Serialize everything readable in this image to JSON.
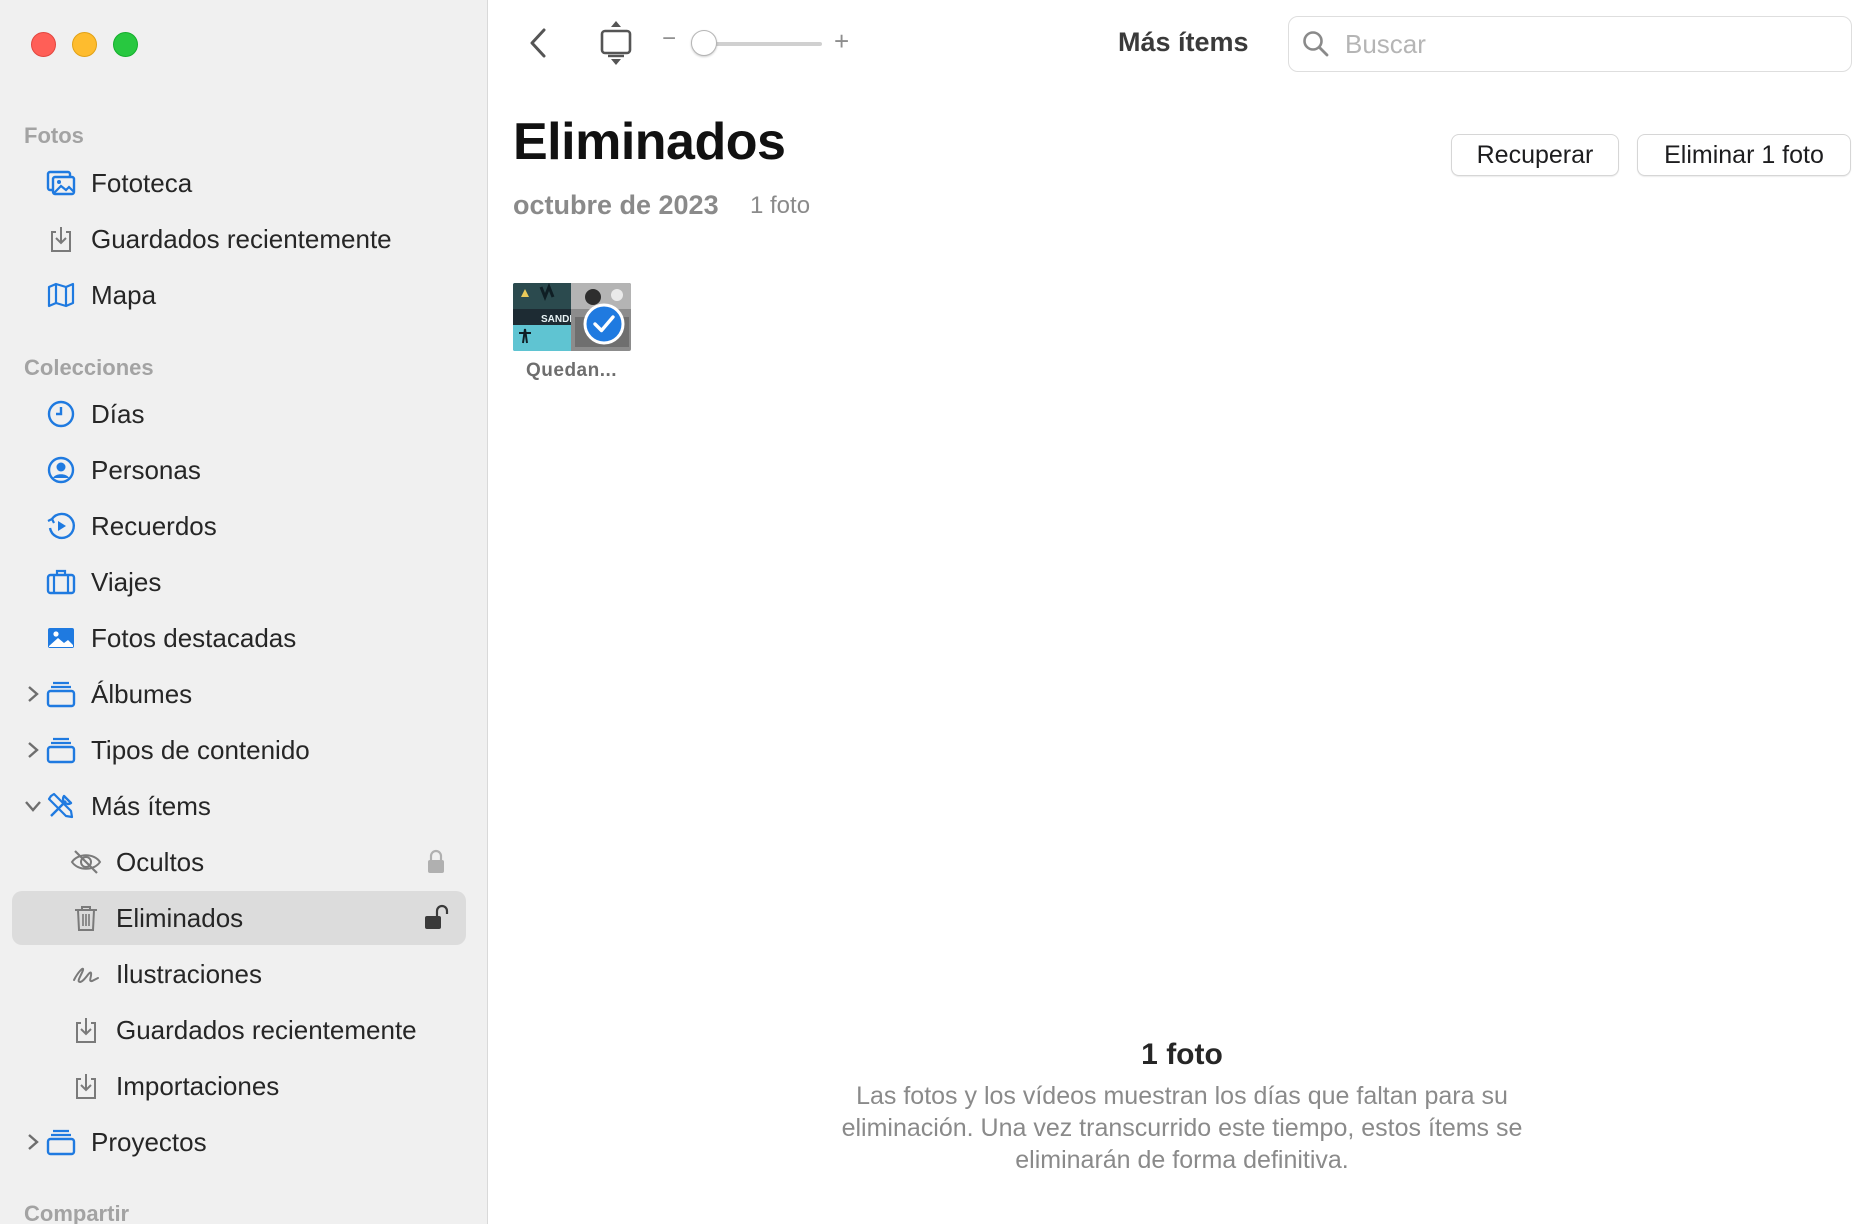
{
  "window": {
    "traffic_lights": [
      "close",
      "minimize",
      "maximize"
    ]
  },
  "sidebar": {
    "sections": {
      "fotos": "Fotos",
      "colecciones": "Colecciones",
      "compartir": "Compartir"
    },
    "items": {
      "fototeca": {
        "label": "Fototeca",
        "icon": "photo-library-icon"
      },
      "guardados": {
        "label": "Guardados recientemente",
        "icon": "download-tray-icon"
      },
      "mapa": {
        "label": "Mapa",
        "icon": "map-icon"
      },
      "dias": {
        "label": "Días",
        "icon": "clock-icon"
      },
      "personas": {
        "label": "Personas",
        "icon": "person-circle-icon"
      },
      "recuerdos": {
        "label": "Recuerdos",
        "icon": "memories-icon"
      },
      "viajes": {
        "label": "Viajes",
        "icon": "suitcase-icon"
      },
      "destacadas": {
        "label": "Fotos destacadas",
        "icon": "photo-icon"
      },
      "albumes": {
        "label": "Álbumes",
        "icon": "stack-icon"
      },
      "tipos": {
        "label": "Tipos de contenido",
        "icon": "stack-icon"
      },
      "mas": {
        "label": "Más ítems",
        "icon": "tools-icon"
      },
      "ocultos": {
        "label": "Ocultos",
        "icon": "eye-slash-icon"
      },
      "eliminados": {
        "label": "Eliminados",
        "icon": "trash-icon"
      },
      "ilustraciones": {
        "label": "Ilustraciones",
        "icon": "scribble-icon"
      },
      "guardados2": {
        "label": "Guardados recientemente",
        "icon": "download-tray-icon"
      },
      "importaciones": {
        "label": "Importaciones",
        "icon": "download-tray-icon"
      },
      "proyectos": {
        "label": "Proyectos",
        "icon": "stack-icon"
      }
    },
    "accent": "#1f7ae0"
  },
  "toolbar": {
    "title": "Más ítems",
    "zoom_minus": "−",
    "zoom_plus": "+",
    "zoom_level": 0.0,
    "search_placeholder": "Buscar"
  },
  "content": {
    "title": "Eliminados",
    "date_group": "octubre de 2023",
    "count": "1 foto",
    "recover_button": "Recuperar",
    "delete_button": "Eliminar 1 foto",
    "photos": [
      {
        "caption": "Quedan...",
        "selected": true
      }
    ],
    "footer_title": "1 foto",
    "footer_text": "Las fotos y los vídeos muestran los días que faltan para su eliminación. Una vez transcurrido este tiempo, estos ítems se eliminarán de forma definitiva."
  }
}
